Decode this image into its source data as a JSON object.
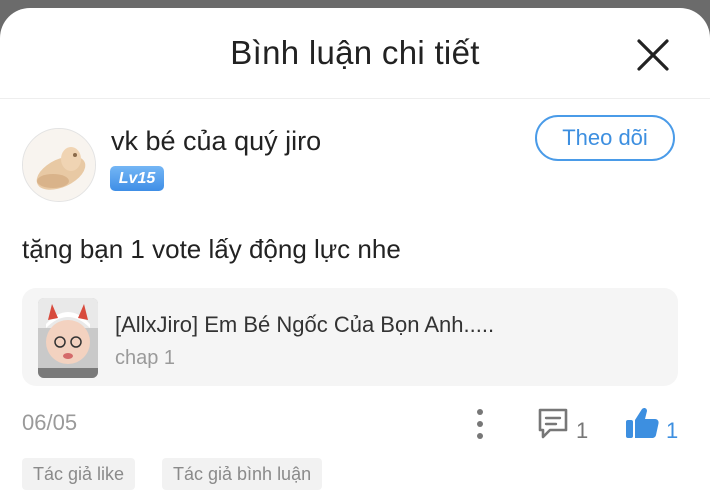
{
  "header": {
    "title": "Bình luận chi tiết",
    "close_icon": "close-icon"
  },
  "comment": {
    "author": {
      "name": "vk bé của quý jiro",
      "level": "Lv15",
      "avatar_icon": "avatar-image"
    },
    "follow_label": "Theo dõi",
    "text": "tặng bạn 1 vote lấy động lực nhe",
    "story": {
      "title": "[AllxJiro] Em Bé Ngốc Của Bọn Anh.....",
      "chapter": "chap 1"
    },
    "date": "06/05",
    "reply_count": "1",
    "like_count": "1",
    "tags": [
      "Tác giả like",
      "Tác giả bình luận"
    ]
  },
  "colors": {
    "accent": "#3d8fe0",
    "badge": "#4a9be8",
    "card_bg": "#f5f5f5",
    "muted": "#9a9a9a",
    "overlay": "#6b6b6b"
  },
  "icons": {
    "more": "more-vertical-icon",
    "reply": "comment-icon",
    "like": "thumbs-up-icon"
  }
}
